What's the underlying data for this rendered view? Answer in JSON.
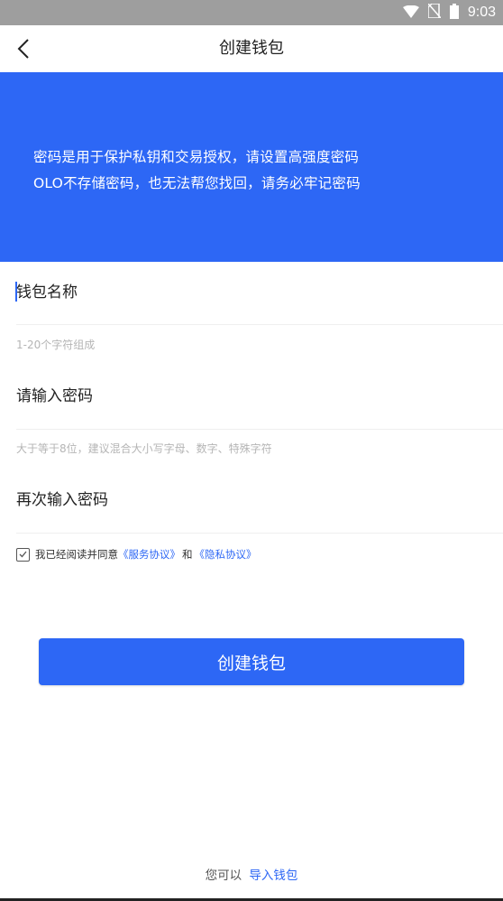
{
  "status_bar": {
    "time": "9:03",
    "icons": [
      "wifi-icon",
      "no-sim-icon",
      "battery-icon"
    ]
  },
  "header": {
    "title": "创建钱包",
    "back_icon": "chevron-left-icon"
  },
  "banner": {
    "line1": "密码是用于保护私钥和交易授权，请设置高强度密码",
    "line2": "OLO不存储密码，也无法帮您找回，请务必牢记密码",
    "color": "#2d67f5"
  },
  "form": {
    "wallet_name": {
      "placeholder": "钱包名称",
      "hint": "1-20个字符组成"
    },
    "password": {
      "placeholder": "请输入密码",
      "hint": "大于等于8位，建议混合大小写字母、数字、特殊字符"
    },
    "password_confirm": {
      "placeholder": "再次输入密码"
    }
  },
  "agreement": {
    "checked": true,
    "prefix": "我已经阅读并同意",
    "service_link": "《服务协议》",
    "and": "和",
    "privacy_link": "《隐私协议》"
  },
  "create_button": {
    "label": "创建钱包"
  },
  "footer": {
    "text": "您可以",
    "import_link": "导入钱包"
  },
  "colors": {
    "accent": "#2d67f5",
    "hint": "#b5b5b5"
  }
}
